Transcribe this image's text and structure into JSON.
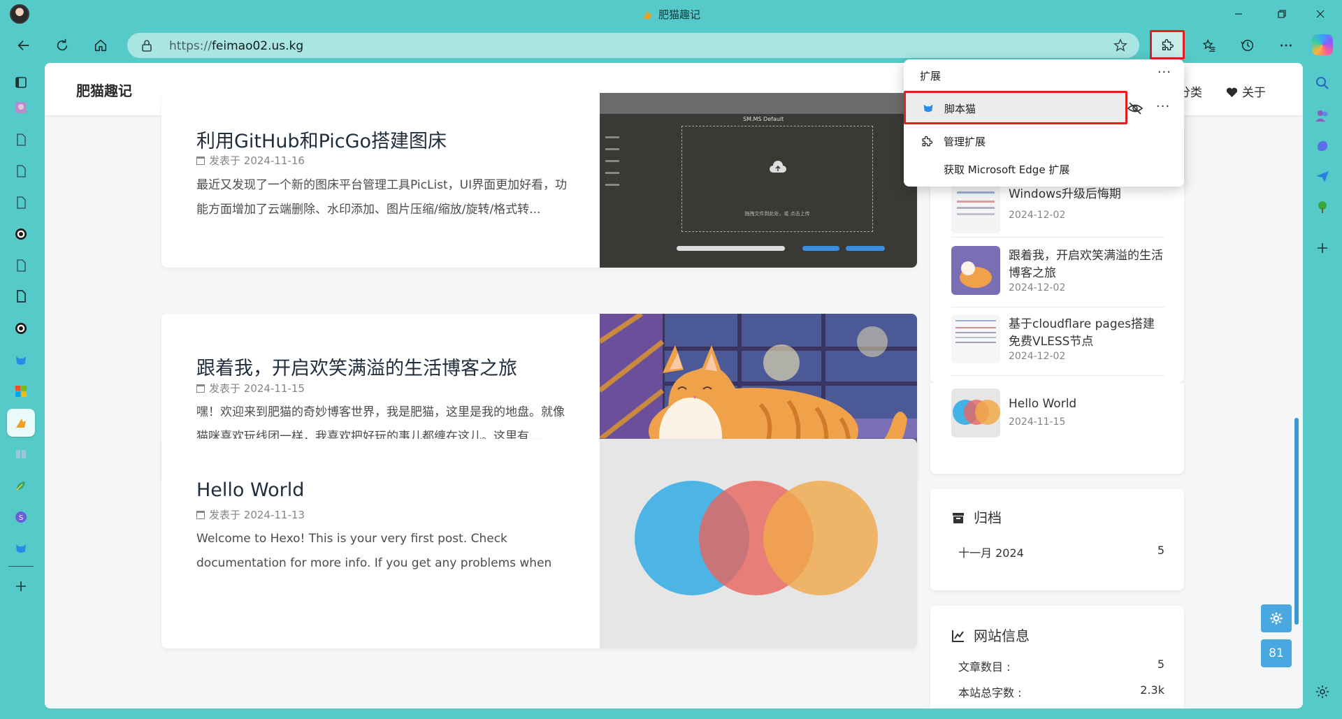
{
  "browser": {
    "window_title": "肥猫趣记",
    "url_prefix": "https://",
    "url_host": "feimao02.us.kg",
    "accent": "#56c9c9"
  },
  "site": {
    "title": "肥猫趣记",
    "nav": [
      {
        "label": "分类"
      },
      {
        "label": "关于"
      }
    ]
  },
  "posts": [
    {
      "title": "利用GitHub和PicGo搭建图床",
      "meta_prefix": "发表于",
      "date": "2024-11-16",
      "excerpt": "最近又发现了一个新的图床平台管理工具PicList，UI界面更加好看，功能方面增加了云端删除、水印添加、图片压缩/缩放/旋转/格式转...",
      "cover": {
        "top_label": "SM.MS   Default",
        "hint": "拖拽文件到此处，或 点击上传"
      }
    },
    {
      "title": "跟着我，开启欢笑满溢的生活博客之旅",
      "meta_prefix": "发表于",
      "date": "2024-11-15",
      "excerpt": "嘿！欢迎来到肥猫的奇妙博客世界，我是肥猫，这里是我的地盘。就像猫咪喜欢玩线团一样，我喜欢把好玩的事儿都缠在这儿。这里有..."
    },
    {
      "title": "Hello World",
      "meta_prefix": "发表于",
      "date": "2024-11-13",
      "excerpt": "Welcome to Hexo! This is your very first post. Check documentation for more info. If you get any problems when using Hexo, you can..."
    }
  ],
  "recent_posts": [
    {
      "title": "",
      "date": "2024-12-02"
    },
    {
      "title": "Windows升级后悔期",
      "date": "2024-12-02"
    },
    {
      "title": "跟着我，开启欢笑满溢的生活博客之旅",
      "date": "2024-12-02"
    },
    {
      "title": "基于cloudflare pages搭建免费VLESS节点",
      "date": "2024-12-02"
    },
    {
      "title": "Hello World",
      "date": "2024-11-15"
    }
  ],
  "archive": {
    "heading": "归档",
    "rows": [
      {
        "label": "十一月 2024",
        "count": "5"
      }
    ]
  },
  "site_info": {
    "heading": "网站信息",
    "rows": [
      {
        "label": "文章数目 :",
        "value": "5"
      },
      {
        "label": "本站总字数 :",
        "value": "2.3k"
      }
    ]
  },
  "float_buttons": {
    "counter": "81"
  },
  "extensions_popup": {
    "header": "扩展",
    "more": "···",
    "item_label": "脚本猫",
    "manage_label": "管理扩展",
    "get_label": "获取 Microsoft Edge 扩展"
  },
  "icons": {
    "back": "arrow-left-icon",
    "refresh": "refresh-icon",
    "home": "home-icon",
    "favorite": "star-icon",
    "extensions": "puzzle-icon",
    "collections": "star-list-icon",
    "history": "history-icon",
    "more": "more-icon"
  }
}
